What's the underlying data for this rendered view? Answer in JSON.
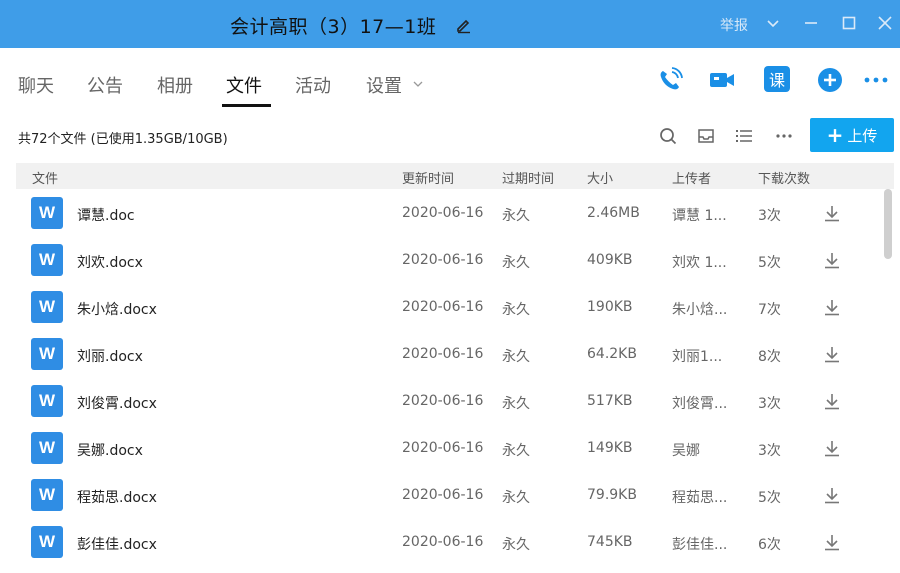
{
  "titlebar": {
    "title": "会计高职（3）17—1班",
    "report": "举报"
  },
  "tabs": [
    {
      "label": "聊天"
    },
    {
      "label": "公告"
    },
    {
      "label": "相册"
    },
    {
      "label": "文件"
    },
    {
      "label": "活动"
    },
    {
      "label": "设置"
    }
  ],
  "active_tab": "文件",
  "toolbar": {
    "course_label": "课",
    "upload_label": "上传"
  },
  "info": {
    "summary": "共72个文件 (已使用1.35GB/10GB)"
  },
  "table": {
    "headers": {
      "file": "文件",
      "updated": "更新时间",
      "expire": "过期时间",
      "size": "大小",
      "uploader": "上传者",
      "downloads": "下载次数"
    },
    "rows": [
      {
        "name": "谭慧.doc",
        "date": "2020-06-16",
        "expire": "永久",
        "size": "2.46MB",
        "uploader": "谭慧 1...",
        "count": "3次"
      },
      {
        "name": "刘欢.docx",
        "date": "2020-06-16",
        "expire": "永久",
        "size": "409KB",
        "uploader": "刘欢 1...",
        "count": "5次"
      },
      {
        "name": "朱小焓.docx",
        "date": "2020-06-16",
        "expire": "永久",
        "size": "190KB",
        "uploader": "朱小焓...",
        "count": "7次"
      },
      {
        "name": "刘丽.docx",
        "date": "2020-06-16",
        "expire": "永久",
        "size": "64.2KB",
        "uploader": "刘丽1...",
        "count": "8次"
      },
      {
        "name": "刘俊霄.docx",
        "date": "2020-06-16",
        "expire": "永久",
        "size": "517KB",
        "uploader": "刘俊霄...",
        "count": "3次"
      },
      {
        "name": "吴娜.docx",
        "date": "2020-06-16",
        "expire": "永久",
        "size": "149KB",
        "uploader": "吴娜",
        "count": "3次"
      },
      {
        "name": "程茹思.docx",
        "date": "2020-06-16",
        "expire": "永久",
        "size": "79.9KB",
        "uploader": "程茹思...",
        "count": "5次"
      },
      {
        "name": "彭佳佳.docx",
        "date": "2020-06-16",
        "expire": "永久",
        "size": "745KB",
        "uploader": "彭佳佳...",
        "count": "6次"
      }
    ]
  },
  "icons": {
    "file_type": "word-doc-icon",
    "file_type_letter": "W"
  },
  "colors": {
    "titlebar": "#3f9de8",
    "accent": "#12a5ef",
    "doc_icon": "#2f8de4"
  }
}
